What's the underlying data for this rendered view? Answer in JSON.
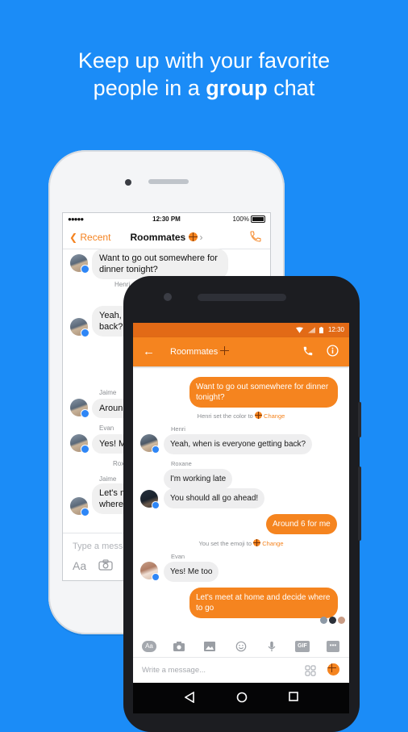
{
  "headline": {
    "line1": "Keep up with your favorite",
    "line2_pre": "people in a ",
    "line2_bold": "group",
    "line2_post": " chat"
  },
  "ios": {
    "status": {
      "signal": "●●●●●",
      "time": "12:30 PM",
      "battery": "100%"
    },
    "nav": {
      "back_label": "Recent",
      "title": "Roommates",
      "chevron": "›"
    },
    "messages": [
      {
        "text_lines": [
          "Want to go out somewhere for",
          "dinner tonight?"
        ]
      },
      {
        "sender": "Henri",
        "text_lines": [
          "Yeah, w",
          "back?"
        ]
      },
      {
        "sender": "Jaime",
        "text_lines": [
          "Aroun"
        ]
      },
      {
        "sender": "Evan",
        "text_lines": [
          "Yes! M"
        ]
      },
      {
        "sender": "Roxa",
        "text_lines": []
      },
      {
        "sender": "Jaime",
        "text_lines": [
          "Let's m",
          "where"
        ]
      }
    ],
    "input": {
      "placeholder": "Type a messa",
      "aa": "Aa"
    }
  },
  "android": {
    "status": {
      "time": "12:30"
    },
    "toolbar": {
      "title": "Roommates"
    },
    "messages": {
      "m1": "Want to go out somewhere for dinner tonight?",
      "sys1": "Henri set the color to",
      "sys1_link": "Change",
      "henri_name": "Henri",
      "m2": "Yeah, when is everyone getting back?",
      "roxane_name": "Roxane",
      "m3": "I'm working late",
      "m4": "You should all go ahead!",
      "m5": "Around 6 for me",
      "sys2": "You set the emoji to",
      "sys2_link": "Change",
      "evan_name": "Evan",
      "m6": "Yes! Me too",
      "m7": "Let's meet at home and decide where to go"
    },
    "composer": {
      "aa": "Aa",
      "gif": "GIF",
      "placeholder": "Write a message..."
    }
  },
  "colors": {
    "background": "#1b8cf7",
    "accent": "#f5841f",
    "accent_dark": "#e26a16",
    "messenger_blue": "#2e86f6"
  }
}
